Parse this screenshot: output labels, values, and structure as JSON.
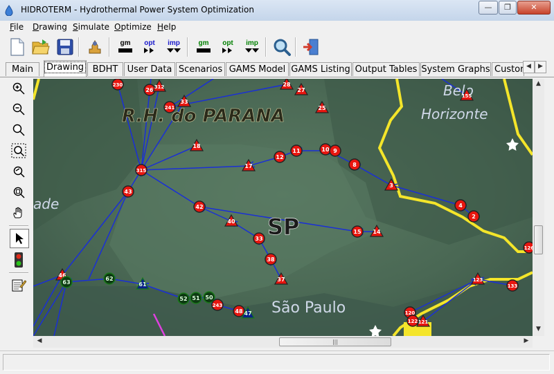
{
  "window": {
    "title": "HIDROTERM - Hydrothermal Power System Optimization",
    "minimize_glyph": "—",
    "restore_glyph": "❐",
    "close_glyph": "✕"
  },
  "menu": [
    {
      "label": "File",
      "mnemonic": "F"
    },
    {
      "label": "Drawing",
      "mnemonic": "D"
    },
    {
      "label": "Simulate",
      "mnemonic": "S"
    },
    {
      "label": "Optimize",
      "mnemonic": "O"
    },
    {
      "label": "Help",
      "mnemonic": "H"
    }
  ],
  "toolbar": {
    "items": [
      {
        "name": "new-file-icon"
      },
      {
        "name": "open-folder-icon"
      },
      {
        "name": "save-disk-icon"
      },
      {
        "name": "plugin-tool-icon"
      },
      {
        "name": "gams-model-icon",
        "label": "gm",
        "color": "#000000"
      },
      {
        "name": "optimize-run-icon",
        "label": "opt",
        "color": "#1a1acc"
      },
      {
        "name": "import-icon",
        "label": "imp",
        "color": "#1a1acc"
      },
      {
        "name": "gams-model-green-icon",
        "label": "gm",
        "color": "#008000"
      },
      {
        "name": "optimize-run-green-icon",
        "label": "opt",
        "color": "#008000"
      },
      {
        "name": "import-green-icon",
        "label": "imp",
        "color": "#008000"
      },
      {
        "name": "search-magnifier-icon"
      },
      {
        "name": "exit-door-icon"
      }
    ]
  },
  "tabs": [
    {
      "label": "Main",
      "active": false
    },
    {
      "label": "Drawing",
      "active": true
    },
    {
      "label": "BDHT",
      "active": false
    },
    {
      "label": "User Data",
      "active": false
    },
    {
      "label": "Scenarios",
      "active": false
    },
    {
      "label": "GAMS Model",
      "active": false
    },
    {
      "label": "GAMS Listing",
      "active": false
    },
    {
      "label": "Output Tables",
      "active": false
    },
    {
      "label": "System Graphs",
      "active": false
    },
    {
      "label": "Custor",
      "active": false
    }
  ],
  "tab_scroll": {
    "left": "◀",
    "right": "▶"
  },
  "left_tools": [
    {
      "name": "zoom-in-icon"
    },
    {
      "name": "zoom-out-icon"
    },
    {
      "name": "zoom-icon"
    },
    {
      "name": "zoom-window-icon"
    },
    {
      "name": "zoom-previous-icon"
    },
    {
      "name": "zoom-extents-icon"
    },
    {
      "name": "pan-hand-icon"
    },
    {
      "name": "select-pointer-icon",
      "selected": true
    },
    {
      "name": "traffic-light-icon"
    },
    {
      "name": "properties-edit-icon"
    }
  ],
  "map": {
    "region_labels": [
      "R.H. do PARANA",
      "SP",
      "Belo",
      "Horizonte",
      "São Paulo",
      "ade"
    ],
    "plants": [
      {
        "id": "230",
        "kind": "circle"
      },
      {
        "id": "26",
        "kind": "circle"
      },
      {
        "id": "312",
        "kind": "triangle"
      },
      {
        "id": "28",
        "kind": "triangle"
      },
      {
        "id": "27",
        "kind": "triangle"
      },
      {
        "id": "33",
        "kind": "triangle"
      },
      {
        "id": "241",
        "kind": "circle"
      },
      {
        "id": "25",
        "kind": "triangle"
      },
      {
        "id": "155",
        "kind": "triangle"
      },
      {
        "id": "18",
        "kind": "triangle"
      },
      {
        "id": "10",
        "kind": "circle"
      },
      {
        "id": "9",
        "kind": "circle"
      },
      {
        "id": "11",
        "kind": "circle"
      },
      {
        "id": "12",
        "kind": "circle"
      },
      {
        "id": "17",
        "kind": "triangle"
      },
      {
        "id": "315",
        "kind": "circle"
      },
      {
        "id": "8",
        "kind": "circle"
      },
      {
        "id": "43",
        "kind": "circle"
      },
      {
        "id": "3",
        "kind": "triangle"
      },
      {
        "id": "42",
        "kind": "circle"
      },
      {
        "id": "4",
        "kind": "circle"
      },
      {
        "id": "2",
        "kind": "circle"
      },
      {
        "id": "40",
        "kind": "triangle"
      },
      {
        "id": "15",
        "kind": "circle"
      },
      {
        "id": "14",
        "kind": "triangle"
      },
      {
        "id": "33",
        "kind": "circle"
      },
      {
        "id": "126",
        "kind": "circle"
      },
      {
        "id": "38",
        "kind": "circle"
      },
      {
        "id": "37",
        "kind": "triangle"
      },
      {
        "id": "46",
        "kind": "triangle"
      },
      {
        "id": "63",
        "kind": "circle-green"
      },
      {
        "id": "62",
        "kind": "circle-green"
      },
      {
        "id": "61",
        "kind": "triangle-green"
      },
      {
        "id": "123",
        "kind": "triangle"
      },
      {
        "id": "133",
        "kind": "circle"
      },
      {
        "id": "52",
        "kind": "circle-green"
      },
      {
        "id": "51",
        "kind": "circle-green"
      },
      {
        "id": "50",
        "kind": "circle-green"
      },
      {
        "id": "243",
        "kind": "circle"
      },
      {
        "id": "48",
        "kind": "circle"
      },
      {
        "id": "47",
        "kind": "triangle-green"
      },
      {
        "id": "120",
        "kind": "circle"
      },
      {
        "id": "121",
        "kind": "triangle"
      },
      {
        "id": "122",
        "kind": "circle"
      }
    ]
  },
  "colors": {
    "node_fill": "#e8160f",
    "node_border": "#222222",
    "link_line": "#1a2fd6",
    "boundary": "#f4e52a",
    "transfer_line": "#e040e0",
    "green_node_border": "#1a7a1a"
  },
  "scroll": {
    "up": "▲",
    "down": "▼",
    "left": "◀",
    "right": "▶",
    "grip": "|||"
  }
}
